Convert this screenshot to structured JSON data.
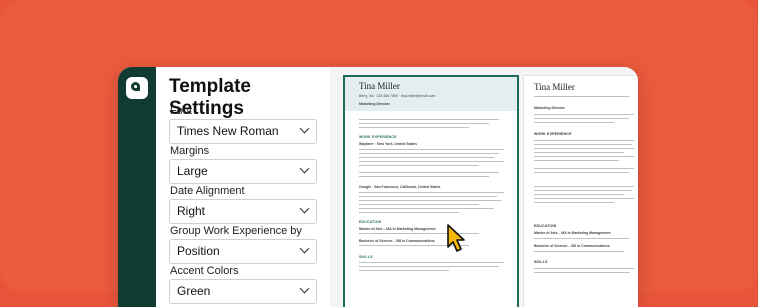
{
  "panel": {
    "title": "Template Settings",
    "fields": [
      {
        "label": "Font",
        "value": "Times New Roman"
      },
      {
        "label": "Margins",
        "value": "Large"
      },
      {
        "label": "Date Alignment",
        "value": "Right"
      },
      {
        "label": "Group Work Experience by",
        "value": "Position"
      },
      {
        "label": "Accent Colors",
        "value": "Green"
      }
    ]
  },
  "resume": {
    "name": "Tina Miller",
    "contact": "Berry, VA · 123 456 7890 · tina.miller@email.com",
    "role": "Marketing Director",
    "sections": [
      "WORK EXPERIENCE",
      "EDUCATION",
      "SKILLS"
    ],
    "employer1": "Wayfarer · New York, United States",
    "employer2": "Google · San Francisco, California, United States",
    "degree1": "Master of Arts – MA in Marketing Management",
    "degree2": "Bachelor of Science – BS in Communications"
  },
  "colors": {
    "background": "#ea5a3d",
    "accent": "#1e6b5a",
    "rail": "#0f3b33"
  }
}
